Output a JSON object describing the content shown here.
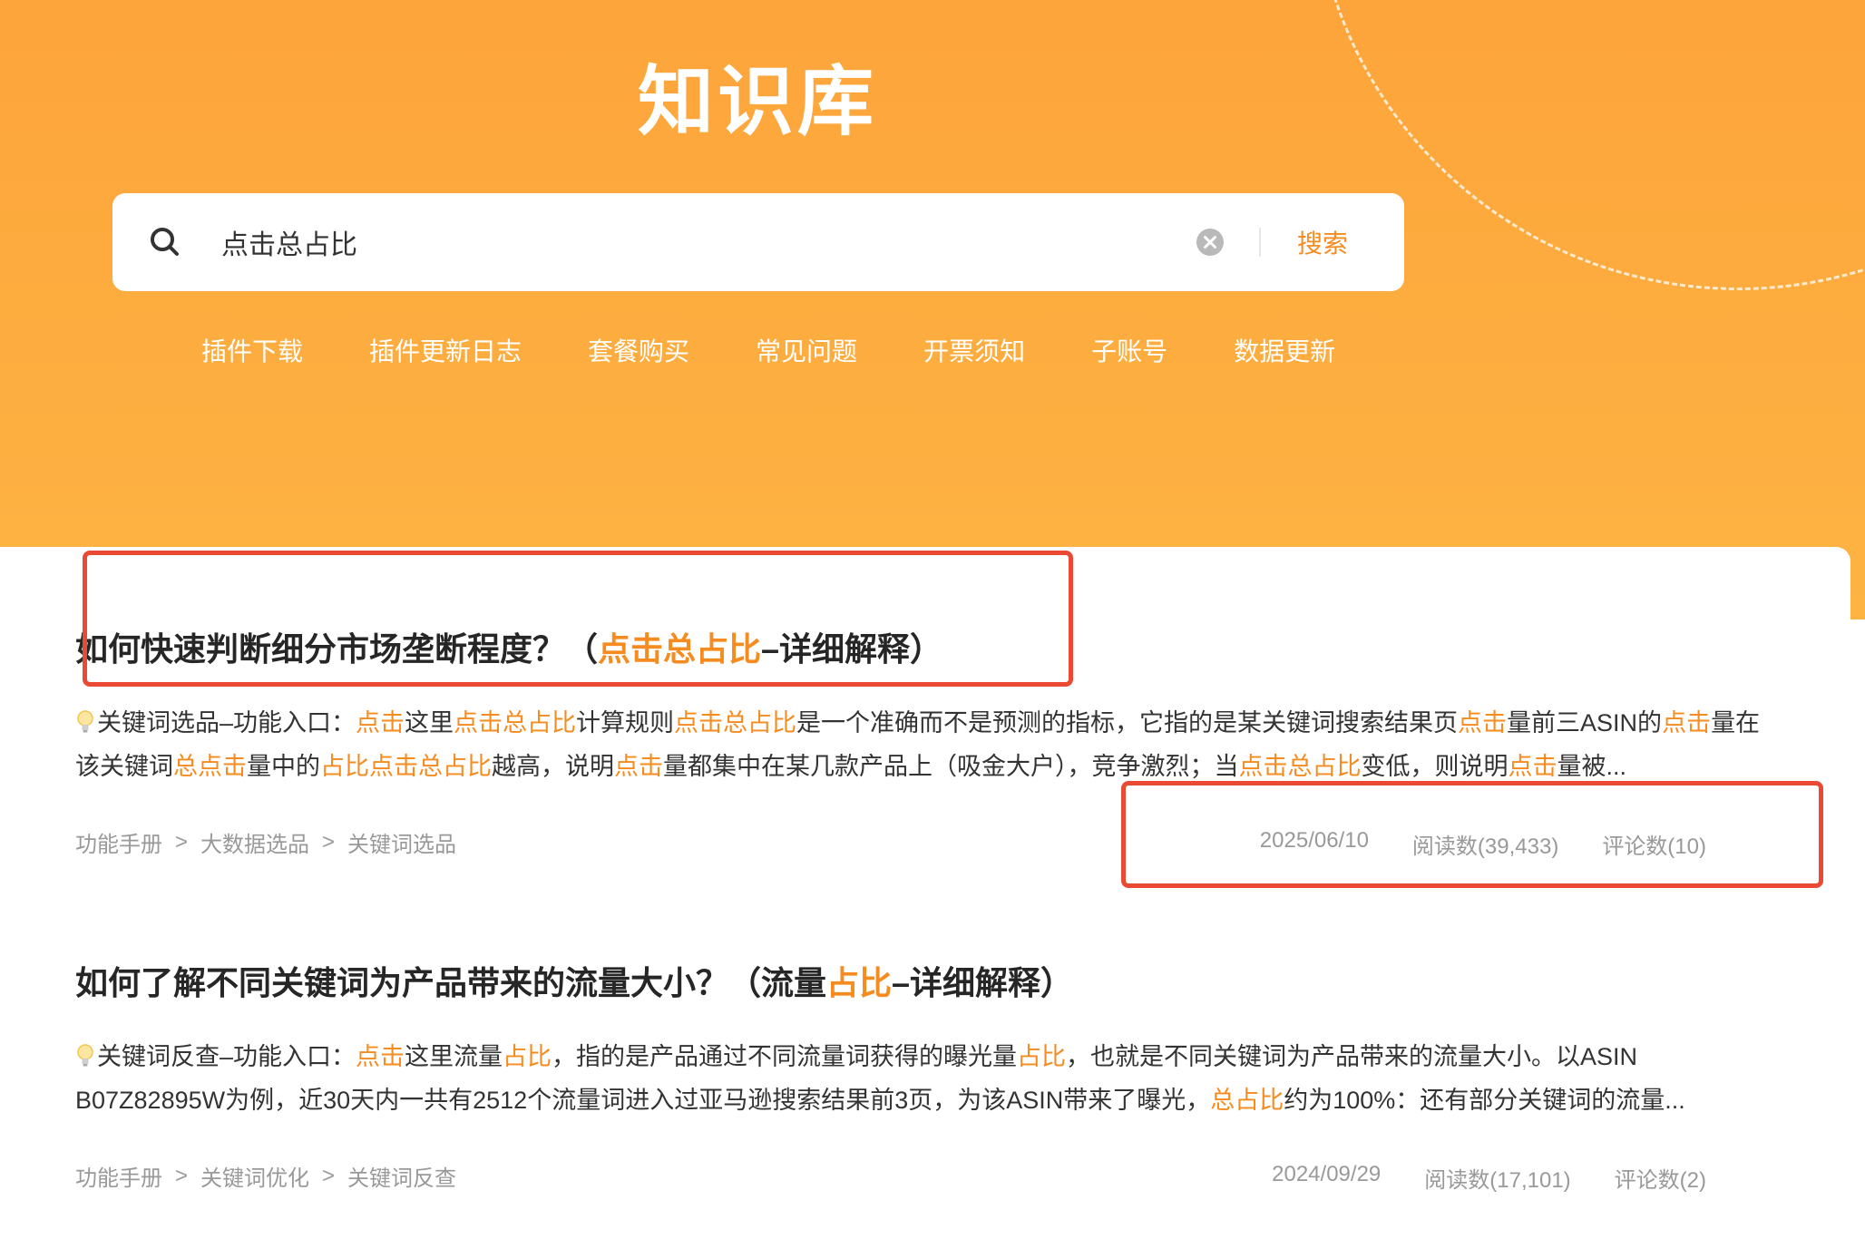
{
  "header": {
    "title": "知识库"
  },
  "search": {
    "value": "点击总占比",
    "button_label": "搜索",
    "icon": "search-icon",
    "clear_icon": "clear-icon"
  },
  "quick_nav": [
    {
      "label": "插件下载"
    },
    {
      "label": "插件更新日志"
    },
    {
      "label": "套餐购买"
    },
    {
      "label": "常见问题"
    },
    {
      "label": "开票须知"
    },
    {
      "label": "子账号"
    },
    {
      "label": "数据更新"
    }
  ],
  "articles": [
    {
      "title_parts": [
        "如何快速判断细分市场垄断程度？（",
        "点击总占比",
        "–详细解释）"
      ],
      "summary_parts": [
        "关键词选品–功能入口：",
        "点击",
        "这里",
        "点击总占比",
        "计算规则",
        "点击总占比",
        "是一个准确而不是预测的指标，它指的是某关键词搜索结果页",
        "点击",
        "量前三ASIN的",
        "点击",
        "量在该关键词",
        "总点击",
        "量中的",
        "占比点击总占比",
        "越高，说明",
        "点击",
        "量都集中在某几款产品上（吸金大户），竞争激烈；当",
        "点击总占比",
        "变低，则说明",
        "点击",
        "量被..."
      ],
      "breadcrumb": [
        "功能手册",
        "大数据选品",
        "关键词选品"
      ],
      "date": "2025/06/10",
      "reads": "阅读数(39,433)",
      "comments": "评论数(10)"
    },
    {
      "title_parts": [
        "如何了解不同关键词为产品带来的流量大小？（流量",
        "占比",
        "–详细解释）"
      ],
      "summary_parts": [
        "关键词反查–功能入口：",
        "点击",
        "这里流量",
        "占比",
        "，指的是产品通过不同流量词获得的曝光量",
        "占比",
        "，也就是不同关键词为产品带来的流量大小。以ASIN B07Z82895W为例，近30天内一共有2512个流量词进入过亚马逊搜索结果前3页，为该ASIN带来了曝光，",
        "总占比",
        "约为100%：还有部分关键词的流量..."
      ],
      "breadcrumb": [
        "功能手册",
        "关键词优化",
        "关键词反查"
      ],
      "date": "2024/09/29",
      "reads": "阅读数(17,101)",
      "comments": "评论数(2)"
    }
  ],
  "breadcrumb_separator": ">",
  "colors": {
    "hero": "#fdab3f",
    "highlight": "#f68b1f",
    "annotation": "#ea4a34",
    "muted": "#999999"
  }
}
